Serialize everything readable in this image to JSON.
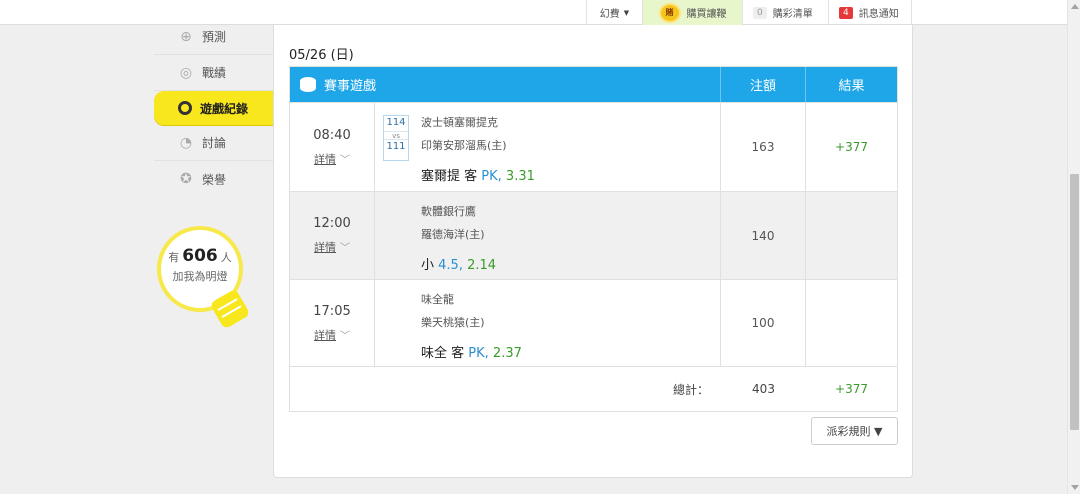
{
  "topbar": {
    "fantasy_label": "幻費",
    "buy_label": "購買讓鞭",
    "buy_coin": "賭",
    "cart_label": "購彩清單",
    "cart_count": "0",
    "notice_label": "訊息通知",
    "notice_count": "4"
  },
  "sidebar": {
    "items": [
      {
        "label": "預測",
        "icon": "target-icon"
      },
      {
        "label": "戰績",
        "icon": "chart-icon"
      },
      {
        "label": "遊戲紀錄",
        "icon": "ring-icon"
      },
      {
        "label": "討論",
        "icon": "chat-icon"
      },
      {
        "label": "榮譽",
        "icon": "medal-icon"
      }
    ],
    "fans": {
      "prefix": "有",
      "count": "606",
      "suffix": "人",
      "line2": "加我為明燈"
    }
  },
  "main": {
    "date": "05/26 (日)",
    "table": {
      "headers": {
        "game": "賽事遊戲",
        "bet": "注額",
        "result": "結果"
      },
      "rows": [
        {
          "time": "08:40",
          "detail": "詳情",
          "score_top": "114",
          "vs": "vs",
          "score_bottom": "111",
          "team1": "波士頓塞爾提克",
          "team2": "印第安那溜馬(主)",
          "pick_text": "塞爾提 客",
          "pick_side": "PK,",
          "pick_odds": "3.31",
          "bet": "163",
          "result": "+377"
        },
        {
          "time": "12:00",
          "detail": "詳情",
          "team1": "軟體銀行鷹",
          "team2": "羅德海洋(主)",
          "pick_text": "小",
          "pick_side": "4.5,",
          "pick_odds": "2.14",
          "bet": "140",
          "result": ""
        },
        {
          "time": "17:05",
          "detail": "詳情",
          "team1": "味全龍",
          "team2": "樂天桃猿(主)",
          "pick_text": "味全 客",
          "pick_side": "PK,",
          "pick_odds": "2.37",
          "bet": "100",
          "result": ""
        }
      ],
      "total_label": "總計：",
      "total_bet": "403",
      "total_result": "+377"
    },
    "rule_button": "派彩規則 ▼"
  }
}
